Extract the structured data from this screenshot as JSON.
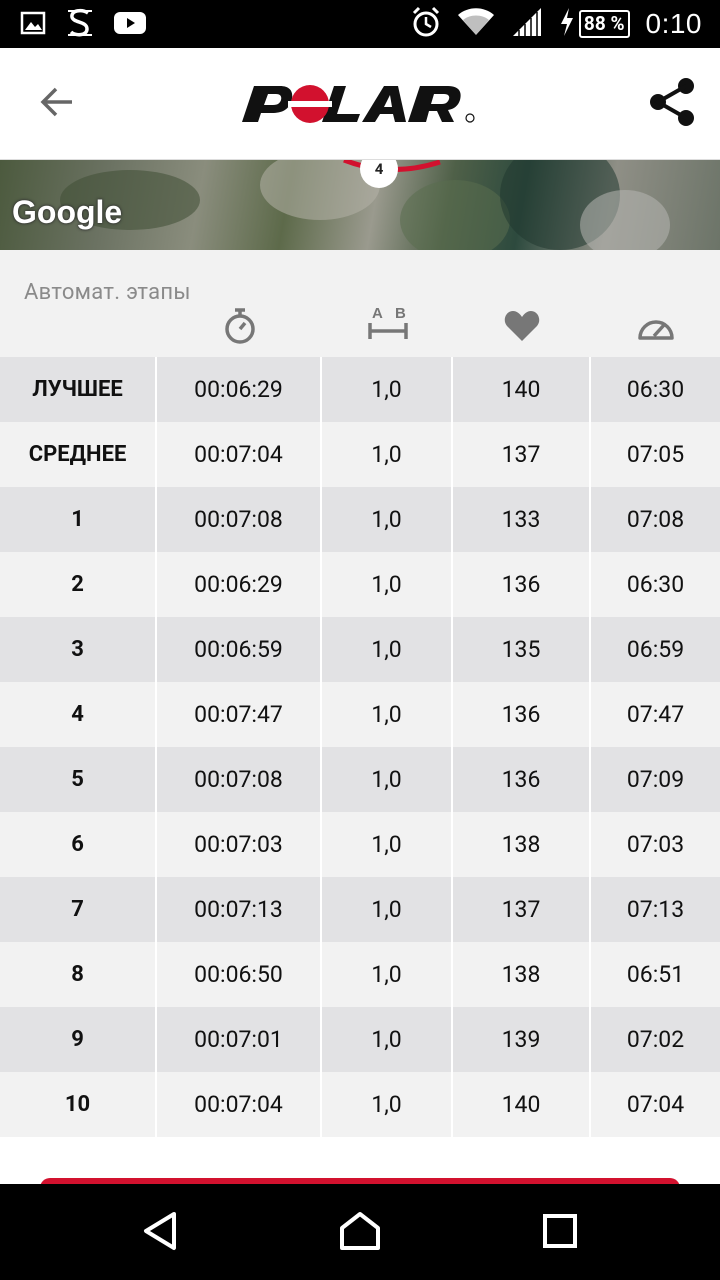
{
  "status_bar": {
    "time": "0:10",
    "battery_percent": "88 %",
    "icons": [
      "image-icon",
      "s-app-icon",
      "youtube-icon",
      "alarm-icon",
      "wifi-icon",
      "signal-icon",
      "charging-icon"
    ]
  },
  "app_bar": {
    "back_icon": "arrow-left-icon",
    "logo_text": "POLAR",
    "share_icon": "share-icon"
  },
  "map": {
    "provider_label": "Google",
    "marker_label": "4"
  },
  "laps": {
    "title": "Автомат. этапы",
    "columns": [
      {
        "icon": "stopwatch-icon"
      },
      {
        "icon": "distance-ab-icon",
        "label_a": "A",
        "label_b": "B"
      },
      {
        "icon": "heart-icon"
      },
      {
        "icon": "pace-gauge-icon"
      }
    ],
    "rows": [
      {
        "name": "ЛУЧШЕЕ",
        "time": "00:06:29",
        "distance": "1,0",
        "hr": "140",
        "pace": "06:30"
      },
      {
        "name": "СРЕДНЕЕ",
        "time": "00:07:04",
        "distance": "1,0",
        "hr": "137",
        "pace": "07:05"
      },
      {
        "name": "1",
        "time": "00:07:08",
        "distance": "1,0",
        "hr": "133",
        "pace": "07:08"
      },
      {
        "name": "2",
        "time": "00:06:29",
        "distance": "1,0",
        "hr": "136",
        "pace": "06:30"
      },
      {
        "name": "3",
        "time": "00:06:59",
        "distance": "1,0",
        "hr": "135",
        "pace": "06:59"
      },
      {
        "name": "4",
        "time": "00:07:47",
        "distance": "1,0",
        "hr": "136",
        "pace": "07:47"
      },
      {
        "name": "5",
        "time": "00:07:08",
        "distance": "1,0",
        "hr": "136",
        "pace": "07:09"
      },
      {
        "name": "6",
        "time": "00:07:03",
        "distance": "1,0",
        "hr": "138",
        "pace": "07:03"
      },
      {
        "name": "7",
        "time": "00:07:13",
        "distance": "1,0",
        "hr": "137",
        "pace": "07:13"
      },
      {
        "name": "8",
        "time": "00:06:50",
        "distance": "1,0",
        "hr": "138",
        "pace": "06:51"
      },
      {
        "name": "9",
        "time": "00:07:01",
        "distance": "1,0",
        "hr": "139",
        "pace": "07:02"
      },
      {
        "name": "10",
        "time": "00:07:04",
        "distance": "1,0",
        "hr": "140",
        "pace": "07:04"
      }
    ]
  },
  "colors": {
    "brand_red": "#d2112e",
    "row_dark": "#e2e2e4",
    "row_light": "#f2f2f2"
  },
  "nav_bar": {
    "icons": [
      "back-triangle-icon",
      "home-icon",
      "recents-icon"
    ]
  }
}
